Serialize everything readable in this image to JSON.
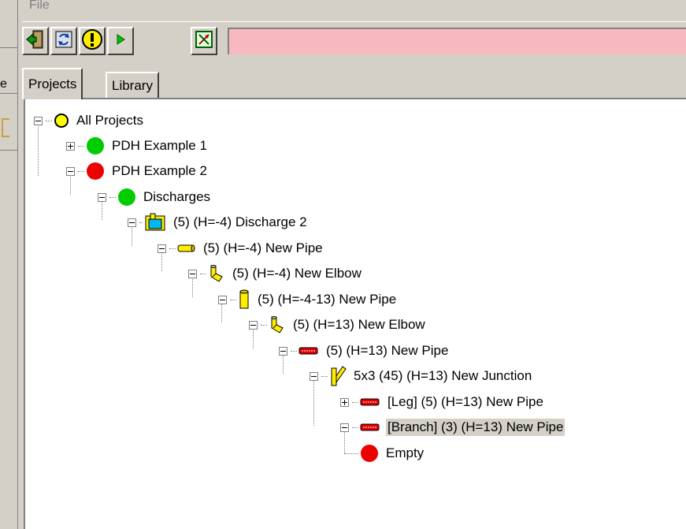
{
  "menu": {
    "file_label": "File"
  },
  "left_strip": {
    "text_e": "e"
  },
  "toolbar": {
    "buttons": [
      {
        "name": "exit-door-icon"
      },
      {
        "name": "refresh-icon"
      },
      {
        "name": "warning-icon"
      },
      {
        "name": "play-icon"
      },
      {
        "name": "crossover-icon"
      }
    ],
    "status_color": "#f8b8c0"
  },
  "tabs": [
    {
      "label": "Projects",
      "active": true
    },
    {
      "label": "Library",
      "active": false
    }
  ],
  "tree": [
    {
      "label": "All Projects",
      "icon": "yellow-circle-icon"
    },
    {
      "label": "PDH Example 1",
      "icon": "green-circle-icon",
      "expander": "plus"
    },
    {
      "label": "PDH Example 2",
      "icon": "red-circle-icon"
    },
    {
      "label": "Discharges",
      "icon": "green-circle-icon"
    },
    {
      "label": "(5) (H=-4) Discharge 2",
      "icon": "discharge-tank-icon"
    },
    {
      "label": "(5) (H=-4) New Pipe",
      "icon": "yellow-pipe-icon"
    },
    {
      "label": "(5) (H=-4) New Elbow",
      "icon": "yellow-elbow-icon"
    },
    {
      "label": "(5) (H=-4-13) New Pipe",
      "icon": "yellow-vertical-pipe-icon"
    },
    {
      "label": "(5) (H=13) New Elbow",
      "icon": "yellow-elbow-icon"
    },
    {
      "label": "(5) (H=13) New Pipe",
      "icon": "red-pipe-icon"
    },
    {
      "label": "5x3 (45)  (H=13) New Junction",
      "icon": "junction-icon"
    },
    {
      "label": "[Leg] (5) (H=13) New Pipe",
      "icon": "red-pipe-icon",
      "expander": "plus"
    },
    {
      "label": "[Branch] (3) (H=13) New Pipe",
      "icon": "red-pipe-icon",
      "selected": true
    },
    {
      "label": "Empty",
      "icon": "red-circle-icon",
      "expander": "none"
    }
  ],
  "colors": {
    "window_bg": "#d4d0c8",
    "status_pink": "#f8b8c0",
    "yellow": "#ffff00",
    "green": "#00cc00",
    "red": "#ee0000"
  }
}
